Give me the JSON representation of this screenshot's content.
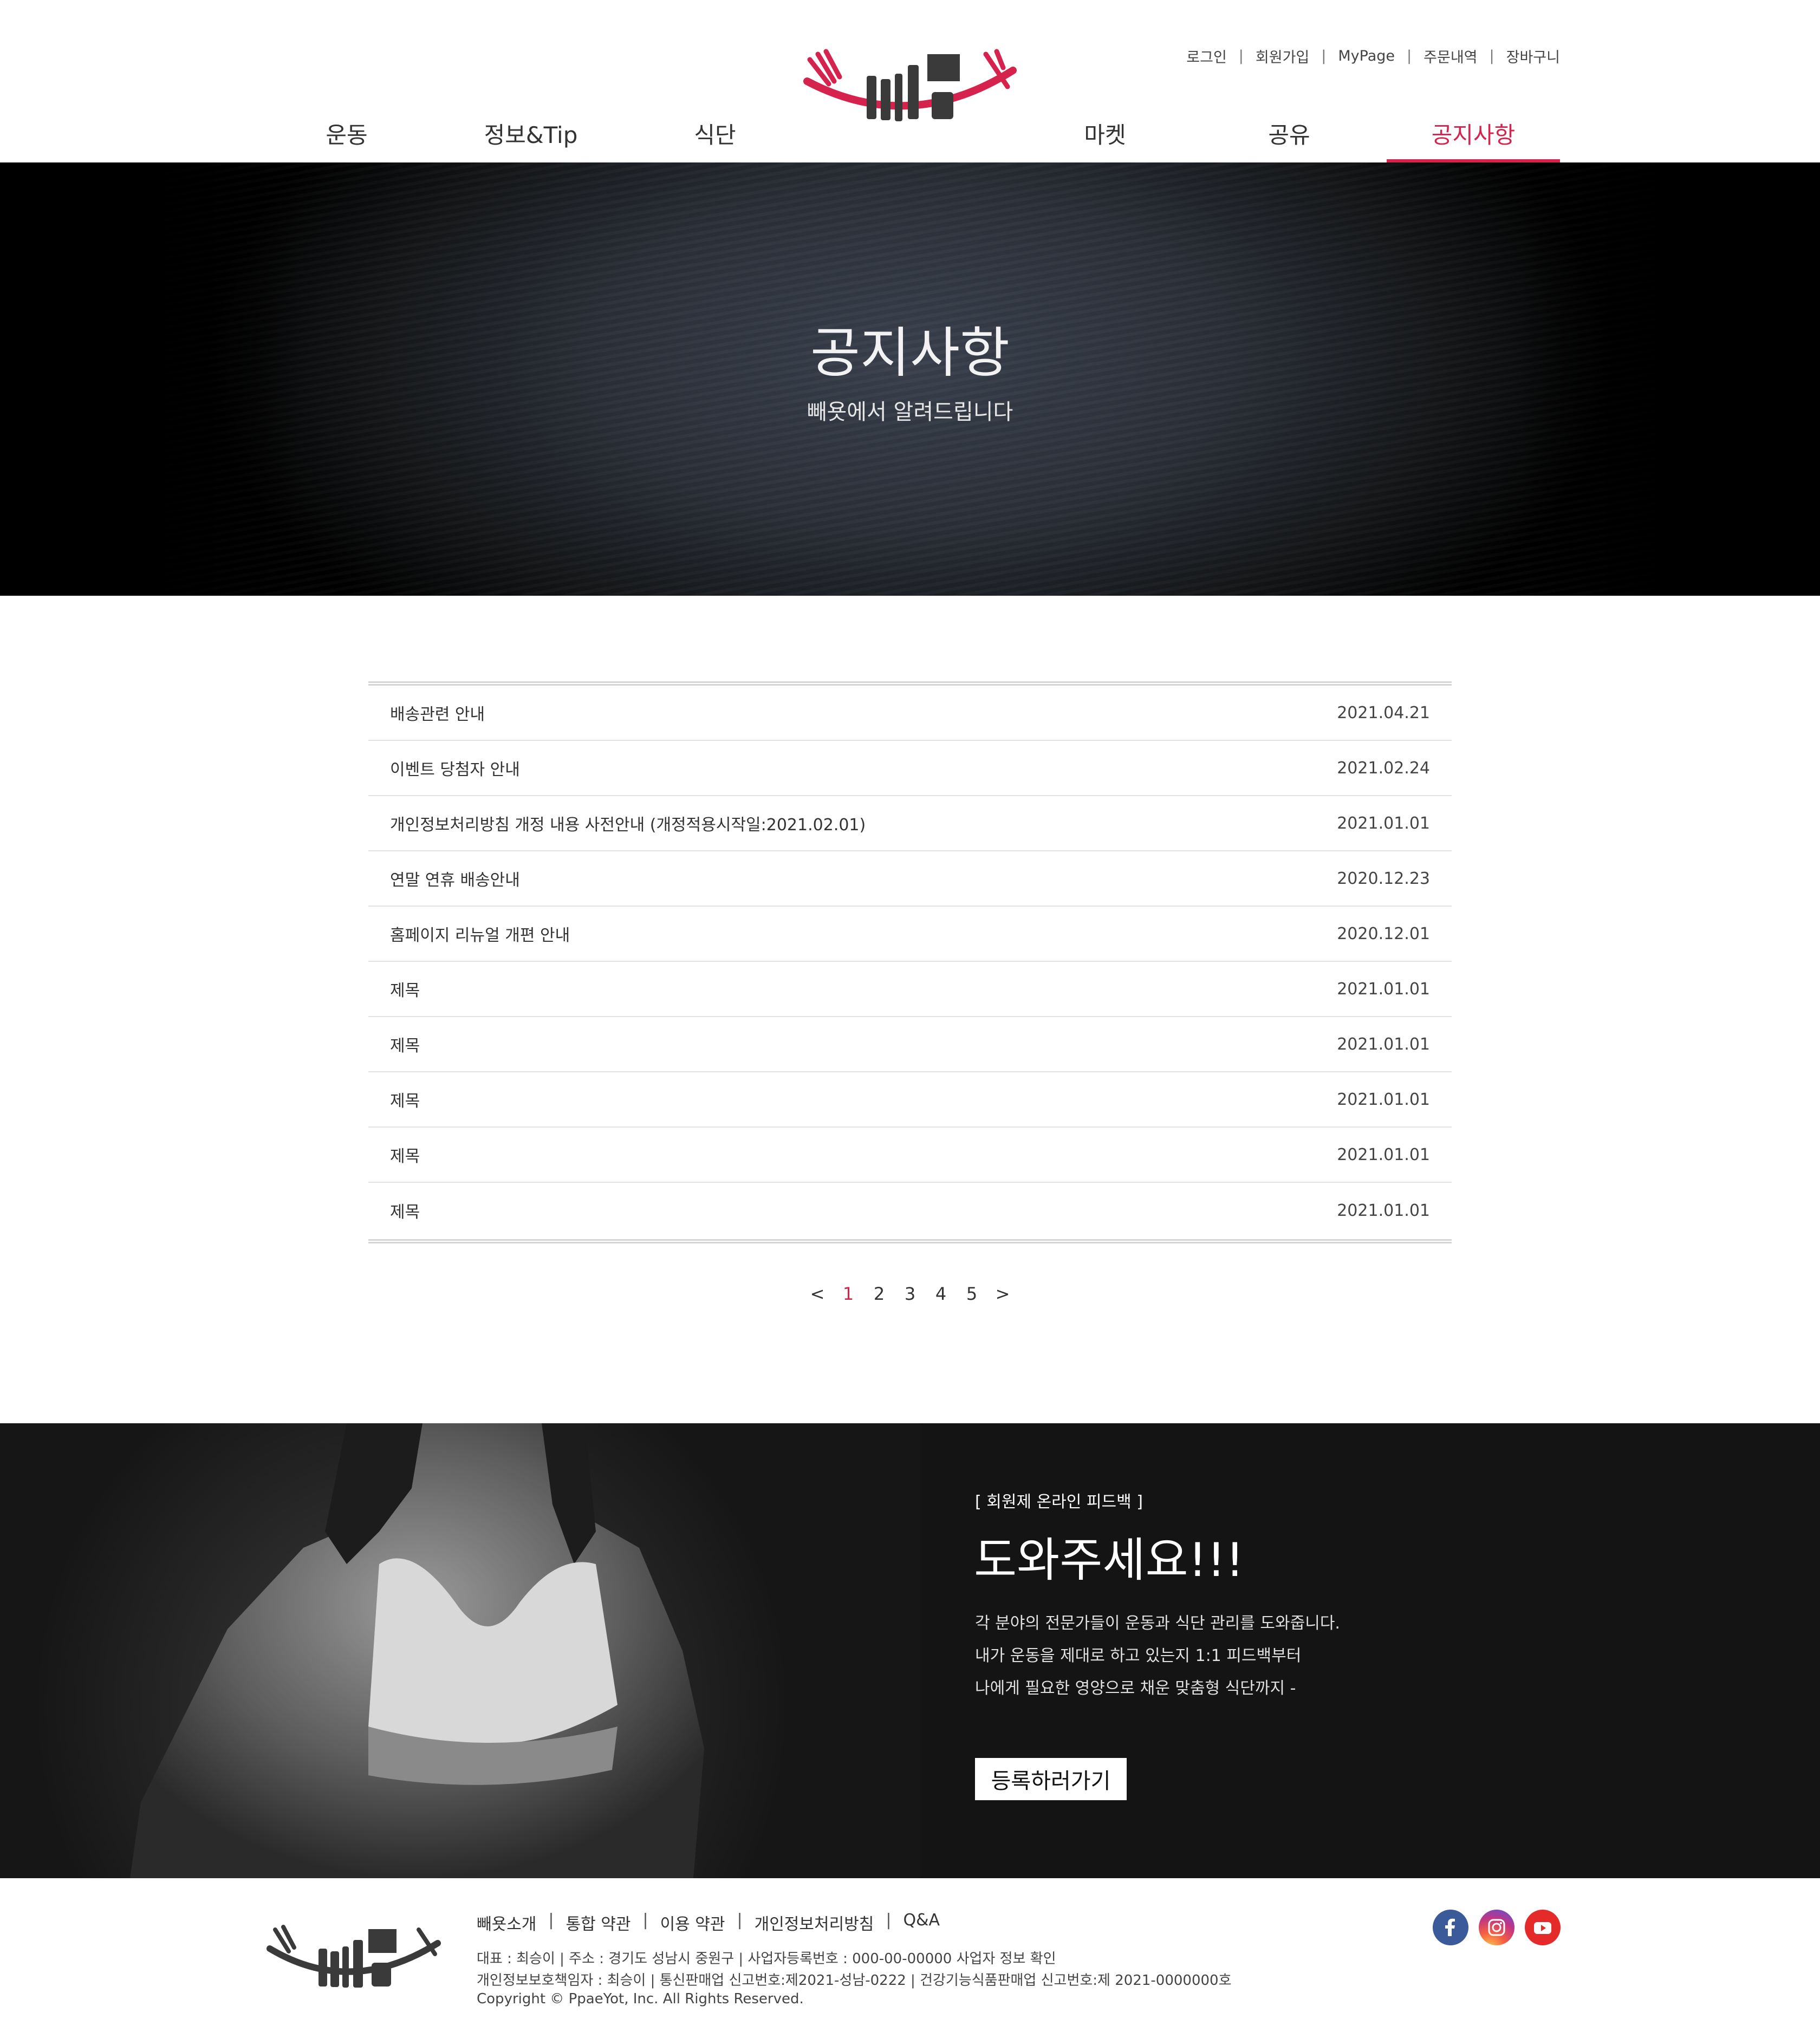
{
  "header": {
    "util_links": [
      "로그인",
      "회원가입",
      "MyPage",
      "주문내역",
      "장바구니"
    ],
    "nav": [
      "운동",
      "정보&Tip",
      "식단",
      "마켓",
      "공유",
      "공지사항"
    ],
    "active_nav": "공지사항"
  },
  "hero": {
    "title": "공지사항",
    "subtitle": "빼욧에서 알려드립니다"
  },
  "notices": [
    {
      "title": "배송관련 안내",
      "date": "2021.04.21"
    },
    {
      "title": "이벤트 당첨자 안내",
      "date": "2021.02.24"
    },
    {
      "title": "개인정보처리방침 개정 내용 사전안내 (개정적용시작일:2021.02.01)",
      "date": "2021.01.01"
    },
    {
      "title": "연말 연휴 배송안내",
      "date": "2020.12.23"
    },
    {
      "title": "홈페이지 리뉴얼 개편 안내",
      "date": "2020.12.01"
    },
    {
      "title": "제목",
      "date": "2021.01.01"
    },
    {
      "title": "제목",
      "date": "2021.01.01"
    },
    {
      "title": "제목",
      "date": "2021.01.01"
    },
    {
      "title": "제목",
      "date": "2021.01.01"
    },
    {
      "title": "제목",
      "date": "2021.01.01"
    }
  ],
  "pagination": {
    "prev": "<",
    "pages": [
      "1",
      "2",
      "3",
      "4",
      "5"
    ],
    "current": "1",
    "next": ">"
  },
  "promo": {
    "tag": "[ 회원제 온라인 피드백 ]",
    "title": "도와주세요!!!",
    "desc": [
      "각 분야의 전문가들이 운동과 식단 관리를 도와줍니다.",
      "내가 운동을 제대로 하고 있는지 1:1 피드백부터",
      "나에게 필요한 영양으로 채운 맞춤형 식단까지 -"
    ],
    "button": "등록하러가기"
  },
  "footer": {
    "links": [
      "빼욧소개",
      "통합 약관",
      "이용 약관",
      "개인정보처리방침",
      "Q&A"
    ],
    "info": [
      "대표 : 최승이 | 주소 : 경기도 성남시 중원구 | 사업자등록번호 : 000-00-00000 사업자 정보 확인",
      "개인정보보호책임자 : 최승이 | 통신판매업 신고번호:제2021-성남-0222 | 건강기능식품판매업 신고번호:제 2021-0000000호",
      "Copyright © PpaeYot, Inc. All Rights Reserved."
    ],
    "social": [
      "facebook-icon",
      "instagram-icon",
      "youtube-icon"
    ]
  },
  "colors": {
    "accent": "#d6234d",
    "logo_red": "#d6234d",
    "logo_dark": "#3a3a3a",
    "promo_bg": "#141414"
  }
}
